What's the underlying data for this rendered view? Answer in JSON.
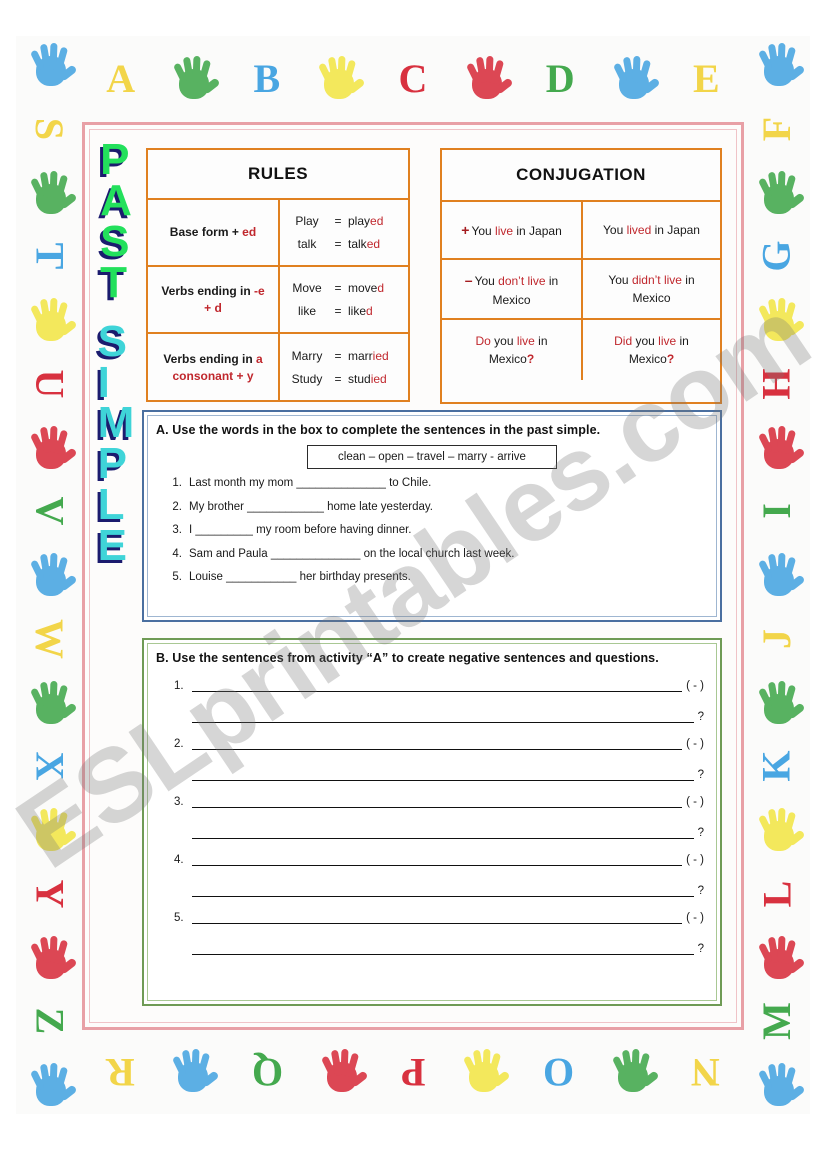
{
  "title_vertical": {
    "word1": "PAST",
    "word2": "SIMPLE",
    "word1_letters": [
      "P",
      "A",
      "S",
      "T"
    ],
    "word2_letters": [
      "S",
      "I",
      "M",
      "P",
      "L",
      "E"
    ],
    "word1_color": "#23e05c",
    "word2_color": "#3fd4d8",
    "shadow_color": "#1b1b6e"
  },
  "rules_table": {
    "header": "RULES",
    "rows": [
      {
        "rule_prefix": "Base form + ",
        "rule_suffix": "ed",
        "examples": [
          {
            "base": "Play",
            "eq": "=",
            "stem": "play",
            "ending": "ed"
          },
          {
            "base": "talk",
            "eq": "=",
            "stem": "talk",
            "ending": "ed"
          }
        ]
      },
      {
        "rule_prefix": "Verbs ending in ",
        "rule_suffix": "-e",
        "rule_line2": "+ d",
        "examples": [
          {
            "base": "Move",
            "eq": "=",
            "stem": "move",
            "ending": "d"
          },
          {
            "base": "like",
            "eq": "=",
            "stem": "like",
            "ending": "d"
          }
        ]
      },
      {
        "rule_prefix": "Verbs ending in ",
        "rule_suffix": "a",
        "rule_line2_prefix": "consonant",
        "rule_line2_suffix": " + y",
        "examples": [
          {
            "base": "Marry",
            "eq": "=",
            "stem": "marr",
            "ending": "ied"
          },
          {
            "base": "Study",
            "eq": "=",
            "stem": "stud",
            "ending": "ied"
          }
        ]
      }
    ]
  },
  "conjugation_table": {
    "header": "CONJUGATION",
    "rows": [
      {
        "sign": "+",
        "present": {
          "p1": "You ",
          "hl": "live",
          "p2": " in Japan"
        },
        "past": {
          "p1": "You ",
          "hl": "lived",
          "p2": " in Japan"
        }
      },
      {
        "sign": "–",
        "present": {
          "p1": "You ",
          "hl": "don’t live",
          "p2": " in",
          "line2": "Mexico"
        },
        "past": {
          "p1": "You ",
          "hl": "didn’t live",
          "p2": " in",
          "line2": "Mexico"
        }
      },
      {
        "sign": "",
        "present": {
          "q1": "Do",
          "p1": " you ",
          "hl": "live",
          "p2": " in",
          "line2": "Mexico",
          "qmark": "?"
        },
        "past": {
          "q1": "Did",
          "p1": " you ",
          "hl": "live",
          "p2": " in",
          "line2": "Mexico",
          "qmark": "?"
        }
      }
    ],
    "accent_color": "#c0272d",
    "border_color": "#e08020"
  },
  "activity_a": {
    "instruction": "A. Use the words in the box to complete the sentences in the past simple.",
    "word_bank": "clean – open – travel – marry - arrive",
    "items": [
      {
        "num": "1.",
        "text": "Last month my mom ______________ to Chile."
      },
      {
        "num": "2.",
        "text": "My brother ____________ home late yesterday."
      },
      {
        "num": "3.",
        "text": "I _________ my room before having dinner."
      },
      {
        "num": "4.",
        "text": "Sam and Paula ______________ on the local church last week."
      },
      {
        "num": "5.",
        "text": " Louise ___________ her birthday presents."
      }
    ],
    "border_color": "#4a6fa0"
  },
  "activity_b": {
    "instruction": "B. Use the sentences from activity “A” to create negative sentences and questions.",
    "groups": [
      {
        "num": "1.",
        "negative_tag": "( - )",
        "question_tag": "?"
      },
      {
        "num": "2.",
        "negative_tag": "( - )",
        "question_tag": "?"
      },
      {
        "num": "3.",
        "negative_tag": "( - )",
        "question_tag": "?"
      },
      {
        "num": "4.",
        "negative_tag": "( - )",
        "question_tag": "?"
      },
      {
        "num": "5.",
        "negative_tag": "( - )",
        "question_tag": "?"
      }
    ],
    "border_color": "#6f9b55"
  },
  "watermark": {
    "text": "ESLprintables.com"
  },
  "decor_border": {
    "top_letters": [
      "A",
      "B",
      "C",
      "D",
      "E"
    ],
    "right_letters": [
      "F",
      "G",
      "H",
      "I",
      "J",
      "K",
      "L",
      "M"
    ],
    "bottom_letters": [
      "N",
      "O",
      "P",
      "Q",
      "R"
    ],
    "left_letters": [
      "S",
      "T",
      "U",
      "V",
      "W",
      "X",
      "Y",
      "Z"
    ],
    "hand_colors": [
      "#3a9fe0",
      "#35a340",
      "#f2e43a",
      "#d62030",
      "#3a9fe0",
      "#35a340",
      "#f2e43a",
      "#d62030"
    ],
    "letter_colors": [
      "#f2d23a",
      "#3a9fe0",
      "#d62030",
      "#35a340",
      "#f2d23a",
      "#3a9fe0",
      "#d62030",
      "#35a340"
    ],
    "frame_color": "#e8a0a6"
  }
}
